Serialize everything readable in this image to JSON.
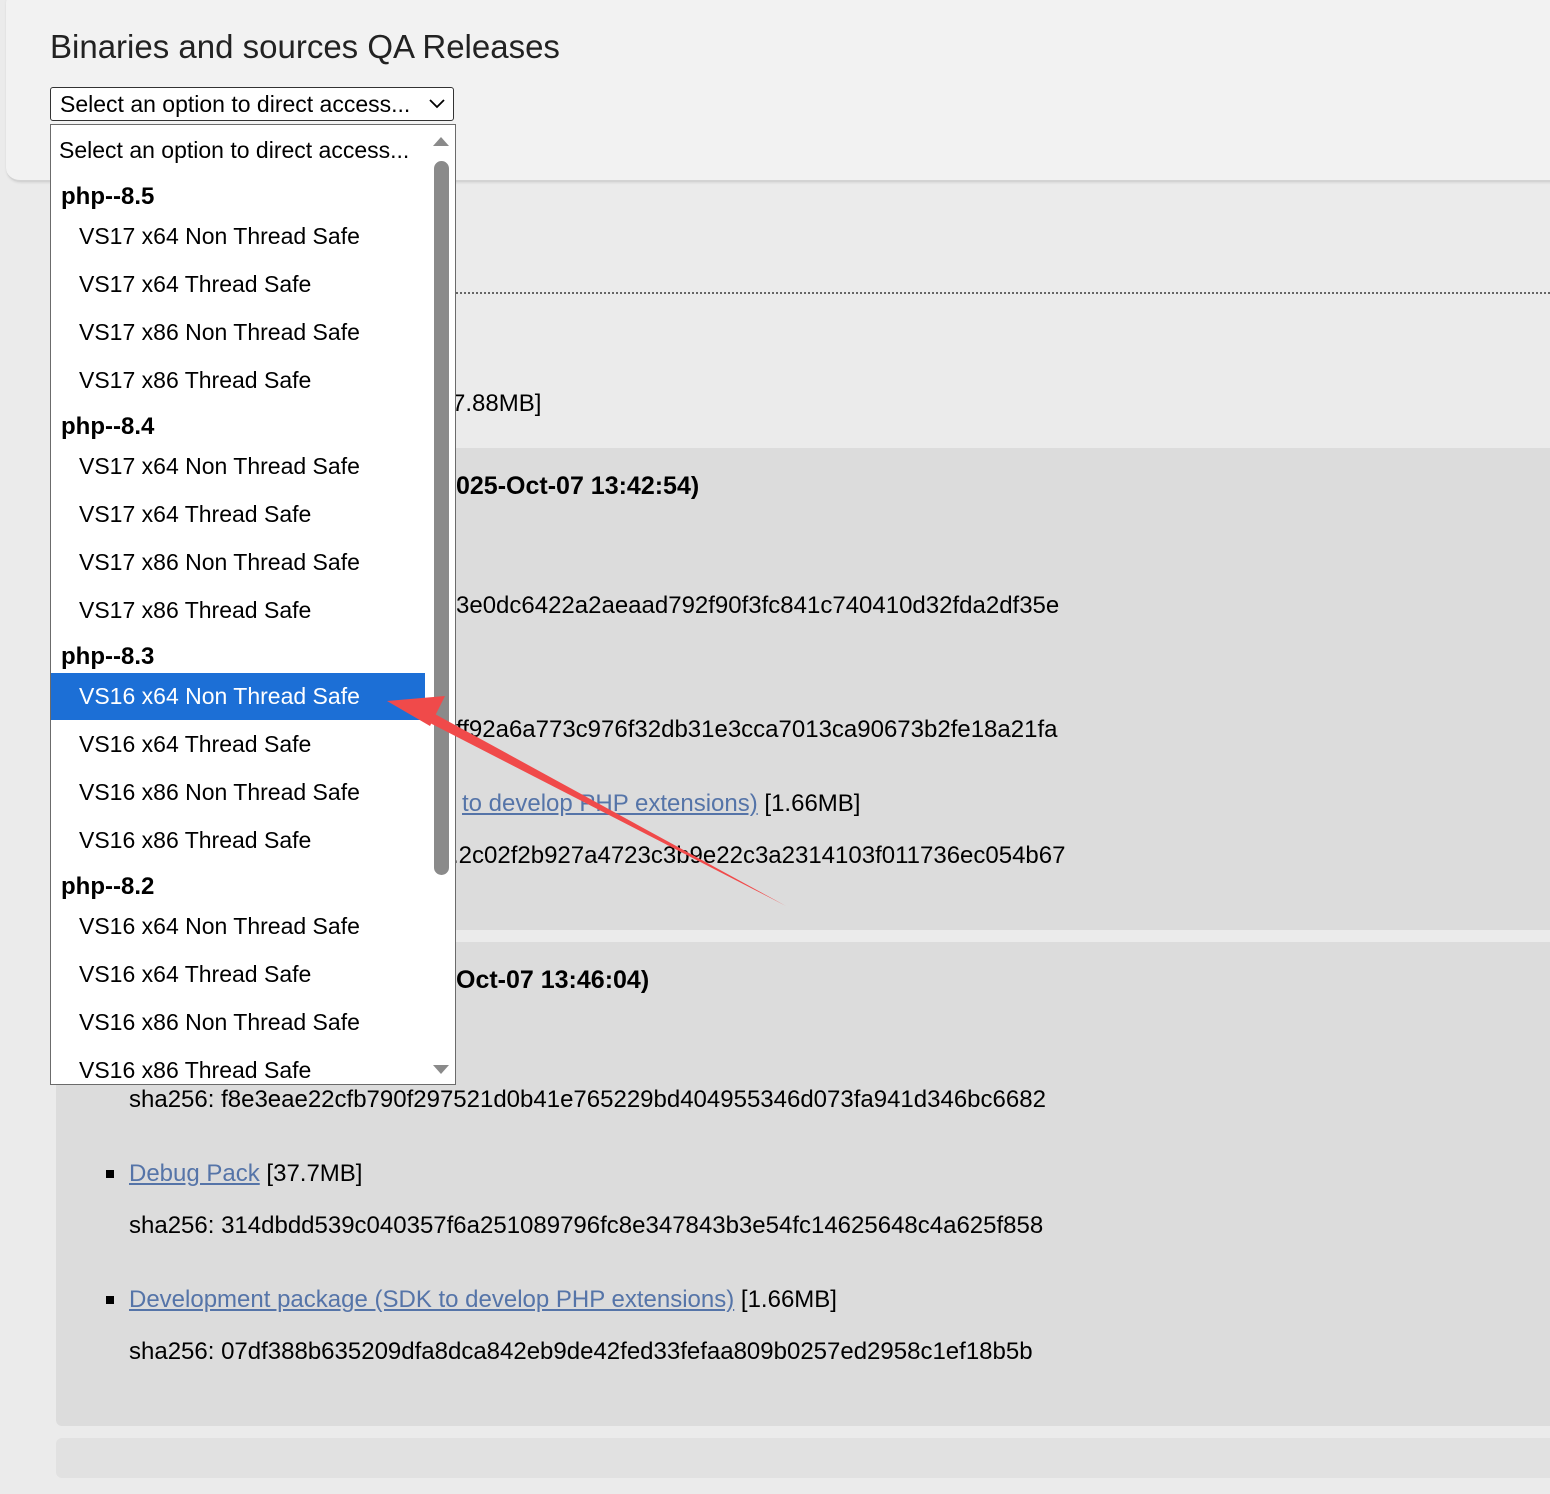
{
  "header": {
    "title": "Binaries and sources QA Releases",
    "select_value": "Select an option to direct access..."
  },
  "dropdown": {
    "placeholder": "Select an option to direct access...",
    "groups": [
      {
        "label": "php--8.5",
        "options": [
          "VS17 x64 Non Thread Safe",
          "VS17 x64 Thread Safe",
          "VS17 x86 Non Thread Safe",
          "VS17 x86 Thread Safe"
        ]
      },
      {
        "label": "php--8.4",
        "options": [
          "VS17 x64 Non Thread Safe",
          "VS17 x64 Thread Safe",
          "VS17 x86 Non Thread Safe",
          "VS17 x86 Thread Safe"
        ]
      },
      {
        "label": "php--8.3",
        "options": [
          "VS16 x64 Non Thread Safe",
          "VS16 x64 Thread Safe",
          "VS16 x86 Non Thread Safe",
          "VS16 x86 Thread Safe"
        ]
      },
      {
        "label": "php--8.2",
        "options": [
          "VS16 x64 Non Thread Safe",
          "VS16 x64 Thread Safe",
          "VS16 x86 Non Thread Safe",
          "VS16 x86 Thread Safe"
        ]
      }
    ],
    "selected": "php--8.3 / VS16 x64 Non Thread Safe"
  },
  "content": {
    "size_partial": "7.88MB]",
    "section1": {
      "heading_partial": "025-Oct-07 13:42:54)",
      "sha_a": "3e0dc6422a2aeaad792f90f3fc841c740410d32fda2df35e",
      "sha_b": "ff92a6a773c976f32db31e3cca7013ca90673b2fe18a21fa",
      "dev_link_partial": "to develop PHP extensions)",
      "dev_size": "[1.66MB]",
      "sha_c": ".2c02f2b927a4723c3b9e22c3a2314103f011736ec054b67"
    },
    "section2": {
      "heading_partial": "Oct-07 13:46:04)",
      "sha_main": "sha256: f8e3eae22cfb790f297521d0b41e765229bd404955346d073fa941d346bc6682",
      "debug_link": "Debug Pack",
      "debug_size": "[37.7MB]",
      "debug_sha": "sha256: 314dbdd539c040357f6a251089796fc8e347843b3e54fc14625648c4a625f858",
      "dev_link": "Development package (SDK to develop PHP extensions)",
      "dev_size": "[1.66MB]",
      "dev_sha": "sha256: 07df388b635209dfa8dca842eb9de42fed33fefaa809b0257ed2958c1ef18b5b"
    }
  },
  "colors": {
    "link": "#5574a8",
    "selected_bg": "#1c6fd6",
    "annotation_arrow": "#f04a4a"
  }
}
